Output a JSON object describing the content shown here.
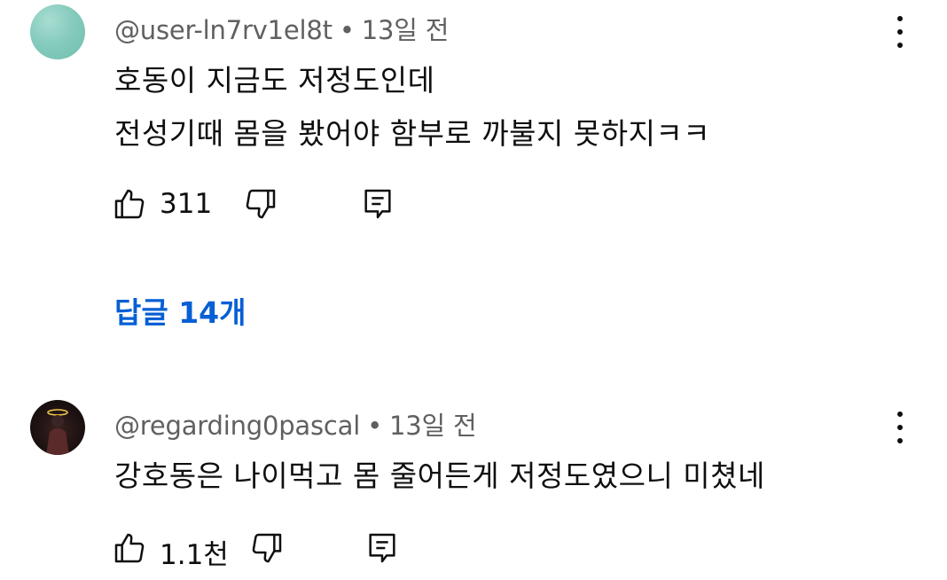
{
  "comments": [
    {
      "author": "@user-ln7rv1el8t",
      "time": "13일 전",
      "lines": [
        "호동이 지금도 저정도인데",
        "전성기때 몸을 봤어야 함부로 까불지 못하지ㅋㅋ"
      ],
      "likes": "311",
      "replies_label": "답글 14개",
      "avatar_color": "#86cbbd"
    },
    {
      "author": "@regarding0pascal",
      "time": "13일 전",
      "lines": [
        "강호동은 나이먹고 몸 줄어든게 저정도였으니 미쳤네"
      ],
      "likes": "1.1천",
      "avatar_color": "#1e1212"
    }
  ],
  "separator": "•",
  "colors": {
    "link": "#065fd4",
    "meta": "#606060",
    "text": "#0f0f0f"
  }
}
